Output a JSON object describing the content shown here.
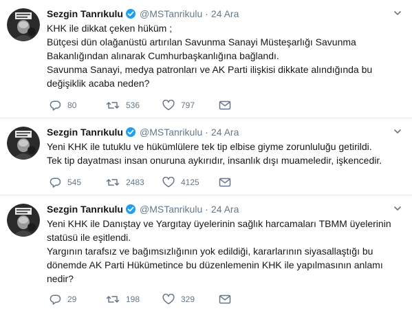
{
  "colors": {
    "name": "#14171a",
    "meta": "#657786",
    "verified": "#1da1f2",
    "divider": "#e6ecf0"
  },
  "icons": [
    "avatar-photo",
    "verified-badge-icon",
    "chevron-down-icon",
    "reply-icon",
    "retweet-icon",
    "like-icon",
    "direct-message-icon"
  ],
  "tweets": [
    {
      "name": "Sezgin Tanrıkulu",
      "handle": "@MSTanrikulu",
      "separator": "·",
      "time": "24 Ara",
      "lines": [
        "KHK ile dikkat çeken hüküm ;",
        "Bütçesi dün olağanüstü artırılan Savunma Sanayi Müsteşarlığı Savunma Bakanlığından alınarak Cumhurbaşkanlığına bağlandı.",
        "Savunma Sanayi, medya patronları ve AK Parti ilişkisi dikkate alındığında bu değişiklik acaba neden?"
      ],
      "replies": "80",
      "retweets": "536",
      "likes": "797"
    },
    {
      "name": "Sezgin Tanrıkulu",
      "handle": "@MSTanrikulu",
      "separator": "·",
      "time": "24 Ara",
      "lines": [
        "Yeni KHK ile tutuklu ve hükümlülere tek tip elbise giyme zorunluluğu getirildi.",
        "Tek tip dayatması insan onuruna aykırıdır, insanlık dışı muameledir, işkencedir."
      ],
      "replies": "545",
      "retweets": "2483",
      "likes": "4125"
    },
    {
      "name": "Sezgin Tanrıkulu",
      "handle": "@MSTanrikulu",
      "separator": "·",
      "time": "24 Ara",
      "lines": [
        "Yeni KHK ile Danıştay ve Yargıtay üyelerinin sağlık harcamaları TBMM üyelerinin statüsü ile eşitlendi.",
        "Yargının tarafsız ve bağımsızlığının yok edildiği, kararlarının siyasallaştığı bu dönemde AK Parti Hükümetince bu düzenlemenin KHK ile yapılmasının anlamı nedir?"
      ],
      "replies": "29",
      "retweets": "198",
      "likes": "329"
    }
  ]
}
